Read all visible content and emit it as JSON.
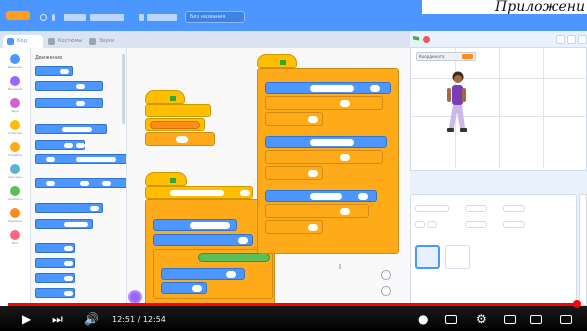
{
  "overlay": {
    "title": "Приложени"
  },
  "menubar": {
    "project_title": "Без названия"
  },
  "tabs": [
    "Код",
    "Костюмы",
    "Звуки"
  ],
  "palette": {
    "section_title": "Движение"
  },
  "categories": [
    "Движение",
    "Внешний вид",
    "Звук",
    "События",
    "Управление",
    "Сенсоры",
    "Операторы",
    "Переменные",
    "Мои блоки"
  ],
  "stage": {
    "monitor_label": "Координата"
  },
  "video": {
    "time": "12:51 / 12:54"
  },
  "colors": {
    "motion": "#4c97ff",
    "events": "#ffbf00",
    "control": "#ffab19",
    "operators": "#59c059",
    "progress": "#ff0000"
  }
}
